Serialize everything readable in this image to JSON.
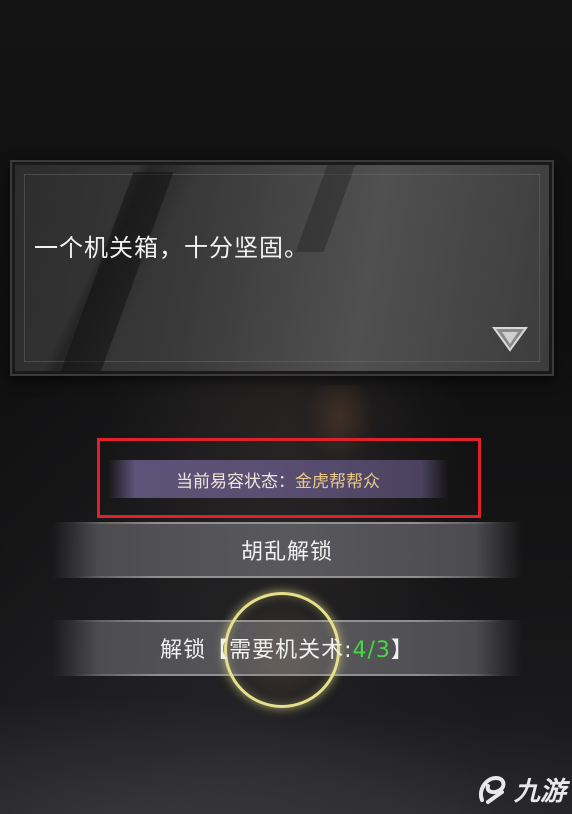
{
  "dialog": {
    "text": "一个机关箱，十分坚固。",
    "advance_icon": "down-triangle-icon"
  },
  "status": {
    "label": "当前易容状态：",
    "value": "金虎帮帮众",
    "highlight_color": "#e0202a"
  },
  "actions": {
    "random_unlock": "胡乱解锁",
    "unlock_prefix": "解锁【需要机关术:",
    "unlock_current": "4",
    "unlock_separator": "/",
    "unlock_required": "3",
    "unlock_suffix": "】"
  },
  "watermark": {
    "text": "九游",
    "logo_icon": "jiuyou-logo-icon"
  },
  "colors": {
    "status_value": "#e8c98a",
    "requirement_ok": "#45d845",
    "cursor_ring": "#e6e08a"
  }
}
